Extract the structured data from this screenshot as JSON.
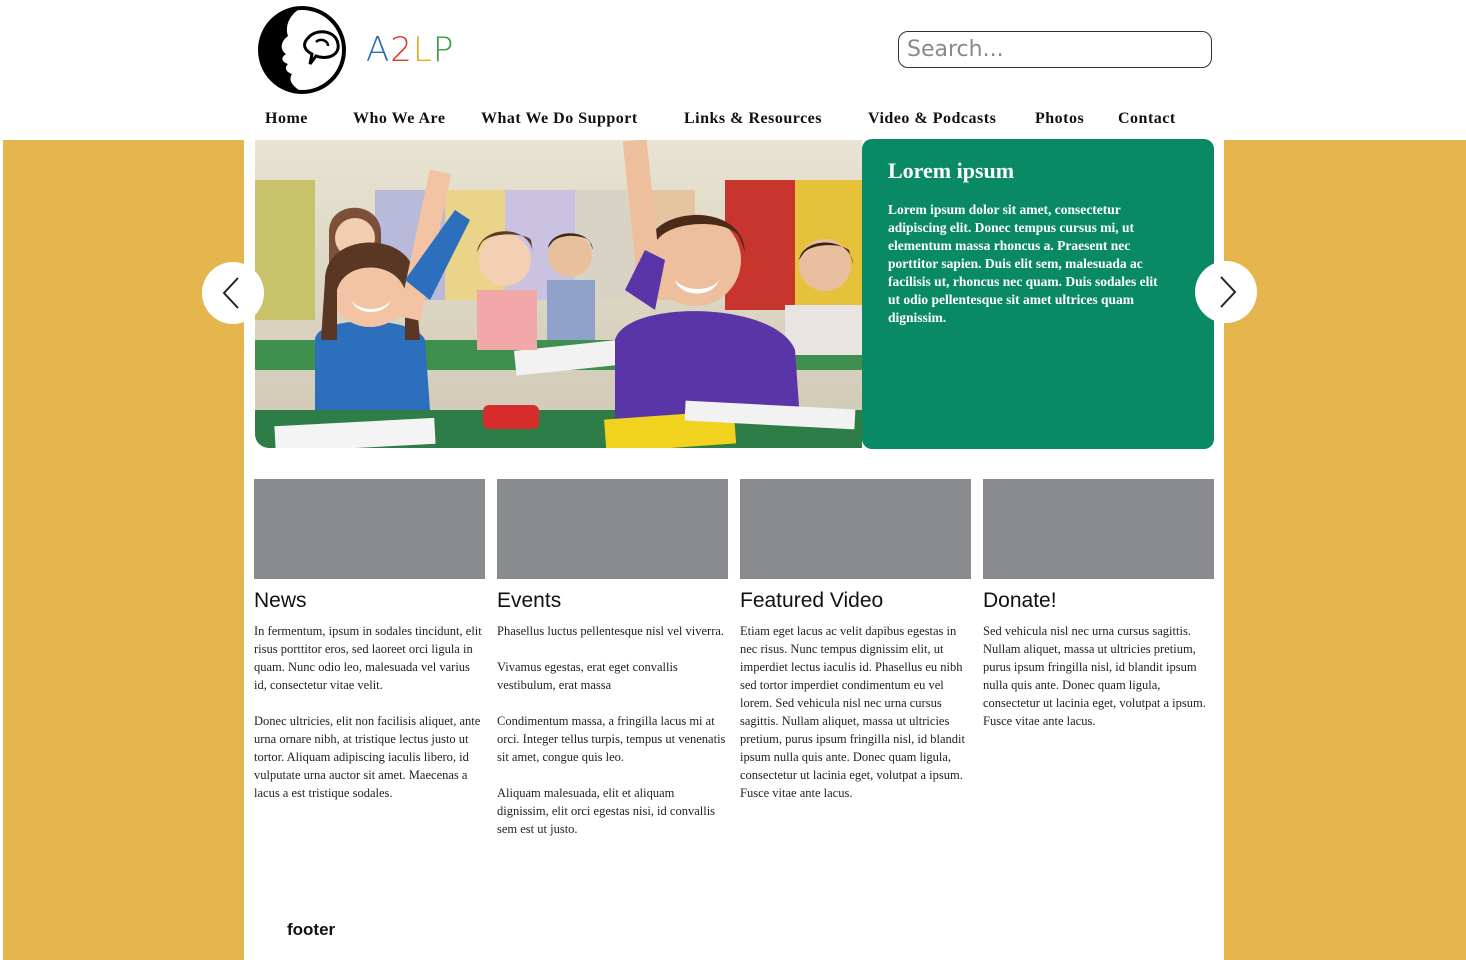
{
  "brand": {
    "name_letters": [
      "A",
      "2",
      "L",
      "P"
    ],
    "letter_colors": [
      "#2B6CB0",
      "#D93A2B",
      "#E7A91C",
      "#3C9A3C"
    ]
  },
  "search": {
    "placeholder": "Search..."
  },
  "nav": {
    "items": [
      {
        "label": "Home"
      },
      {
        "label": "Who We Are"
      },
      {
        "label": "What We Do Support"
      },
      {
        "label": "Links & Resources"
      },
      {
        "label": "Video & Podcasts"
      },
      {
        "label": "Photos"
      },
      {
        "label": "Contact"
      }
    ]
  },
  "hero": {
    "title": "Lorem ipsum",
    "body": "Lorem ipsum dolor sit amet, consectetur adipiscing elit. Donec tempus cursus mi, ut elementum massa rhoncus a. Praesent nec porttitor sapien. Duis elit sem, malesuada ac facilisis ut, rhoncus nec quam. Duis sodales elit ut odio pellentesque sit amet ultrices quam dignissim.",
    "prev_icon": "chevron-left-icon",
    "next_icon": "chevron-right-icon",
    "card_color": "#0A8A64"
  },
  "columns": [
    {
      "title": "News",
      "paragraphs": [
        "In fermentum, ipsum in sodales tincidunt, elit risus porttitor eros, sed laoreet orci ligula in quam. Nunc odio leo, malesuada vel varius id, consectetur vitae velit.",
        "Donec ultricies, elit non facilisis aliquet, ante urna ornare nibh, at tristique lectus justo ut tortor. Aliquam adipiscing iaculis libero, id vulputate urna auctor sit amet. Maecenas a lacus a est tristique sodales."
      ]
    },
    {
      "title": "Events",
      "paragraphs": [
        "Phasellus luctus pellentesque nisl vel viverra.",
        "Vivamus egestas, erat eget convallis vestibulum, erat massa",
        "Condimentum massa, a fringilla lacus mi at orci. Integer tellus turpis, tempus ut venenatis sit amet, congue quis leo.",
        "Aliquam malesuada, elit et aliquam dignissim, elit orci egestas nisi, id convallis sem est ut justo."
      ]
    },
    {
      "title": "Featured Video",
      "paragraphs": [
        "Etiam eget lacus ac velit dapibus egestas in nec risus. Nunc tempus dignissim elit, ut imperdiet lectus iaculis id. Phasellus eu nibh sed tortor imperdiet condimentum eu vel lorem. Sed vehicula nisl nec urna cursus sagittis. Nullam aliquet, massa ut ultricies pretium, purus ipsum fringilla nisl, id blandit ipsum nulla quis ante. Donec quam ligula, consectetur ut lacinia eget, volutpat a ipsum. Fusce vitae ante lacus."
      ]
    },
    {
      "title": "Donate!",
      "paragraphs": [
        "Sed vehicula nisl nec urna cursus sagittis. Nullam aliquet, massa ut ultricies pretium, purus ipsum fringilla nisl, id blandit ipsum nulla quis ante. Donec quam ligula, consectetur ut lacinia eget, volutpat a ipsum. Fusce vitae ante lacus."
      ]
    }
  ],
  "footer": {
    "label": "footer"
  },
  "colors": {
    "page_band": "#E5B54E",
    "thumb_gray": "#8A8B8F"
  }
}
